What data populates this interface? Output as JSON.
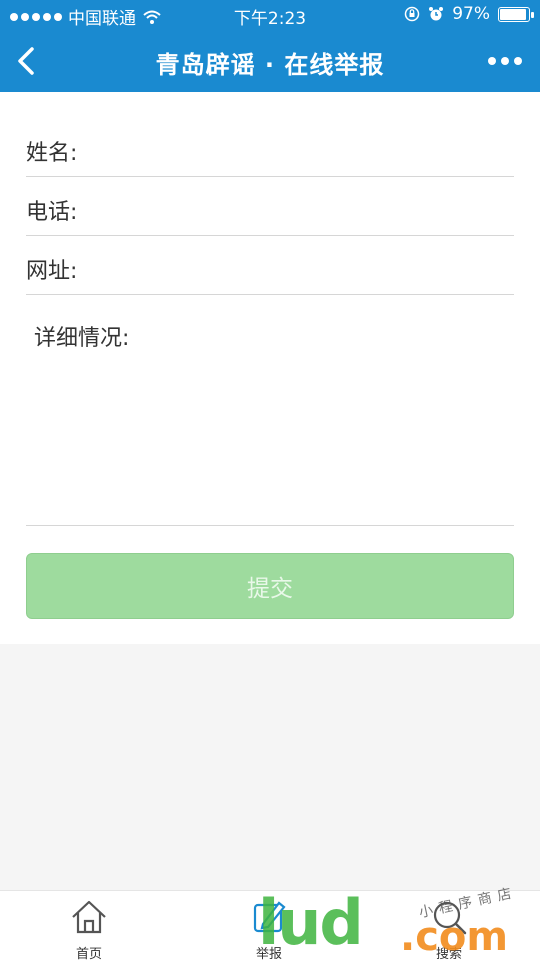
{
  "status_bar": {
    "carrier": "中国联通",
    "time": "下午2:23",
    "battery_percent": "97%",
    "battery_level": 0.97
  },
  "nav": {
    "title": "青岛辟谣 · 在线举报"
  },
  "form": {
    "name_label": "姓名:",
    "phone_label": "电话:",
    "url_label": "网址:",
    "details_label": "详细情况:",
    "name_value": "",
    "phone_value": "",
    "url_value": "",
    "details_value": ""
  },
  "submit_label": "提交",
  "tabs": [
    {
      "label": "首页",
      "icon": "home-icon"
    },
    {
      "label": "举报",
      "icon": "report-icon"
    },
    {
      "label": "搜索",
      "icon": "search-icon"
    }
  ],
  "watermark": {
    "brand": "lud",
    "suffix": ".com",
    "tagline": "小程序商店"
  },
  "colors": {
    "primary": "#1a8ad0",
    "submit_bg": "#9edb9e",
    "page_bg": "#f5f5f5"
  }
}
